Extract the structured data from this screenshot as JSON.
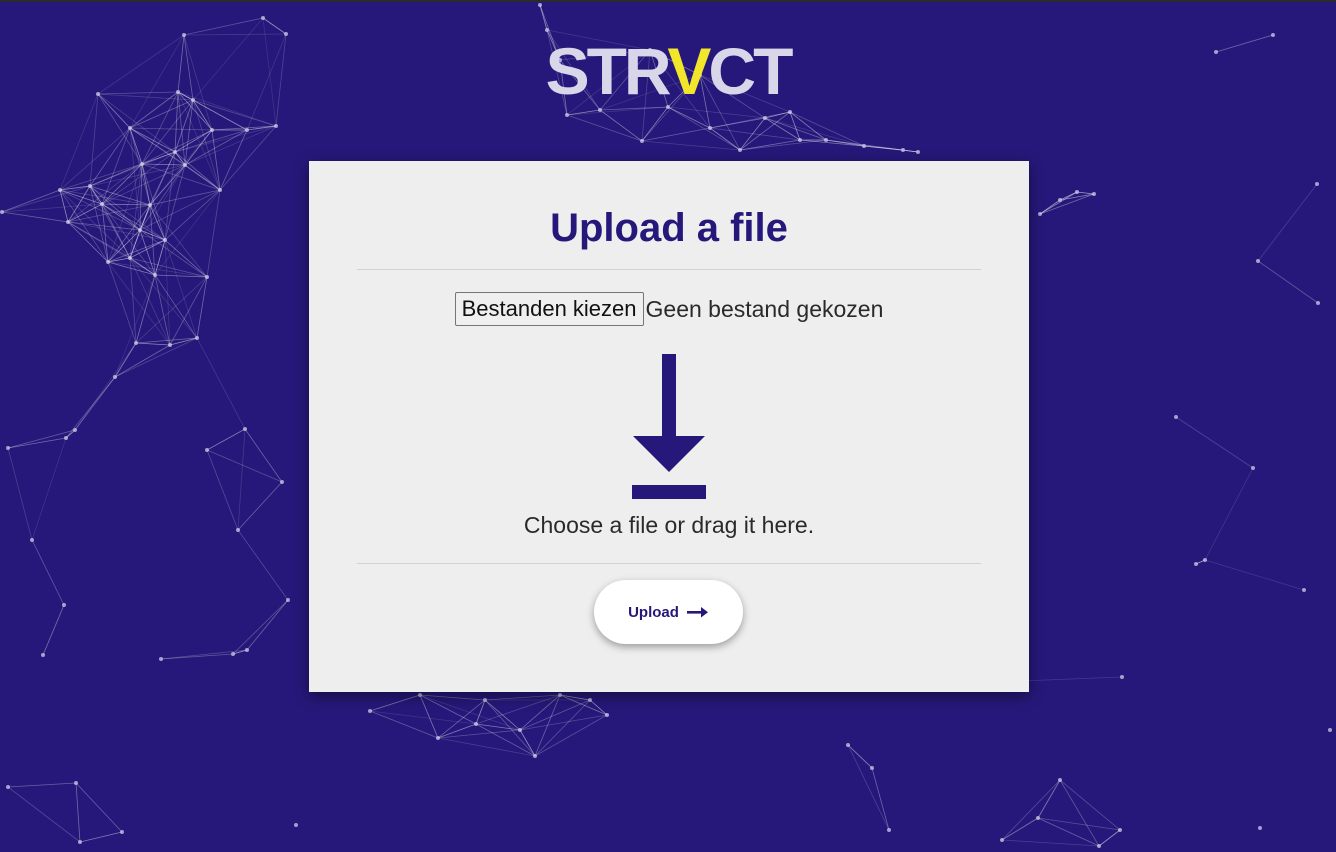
{
  "logo": {
    "prefix": "STR",
    "accent_letter": "V",
    "suffix": "CT",
    "accent_color": "#f2e62a"
  },
  "colors": {
    "background": "#26187a",
    "card": "#eeeeee",
    "primary": "#26187a"
  },
  "upload_card": {
    "title": "Upload a file",
    "file_button_label": "Bestanden kiezen",
    "file_status": "Geen bestand gekozen",
    "drop_icon": "download-arrow-icon",
    "hint": "Choose a file or drag it here.",
    "submit_label": "Upload",
    "submit_icon": "arrow-right-icon"
  }
}
